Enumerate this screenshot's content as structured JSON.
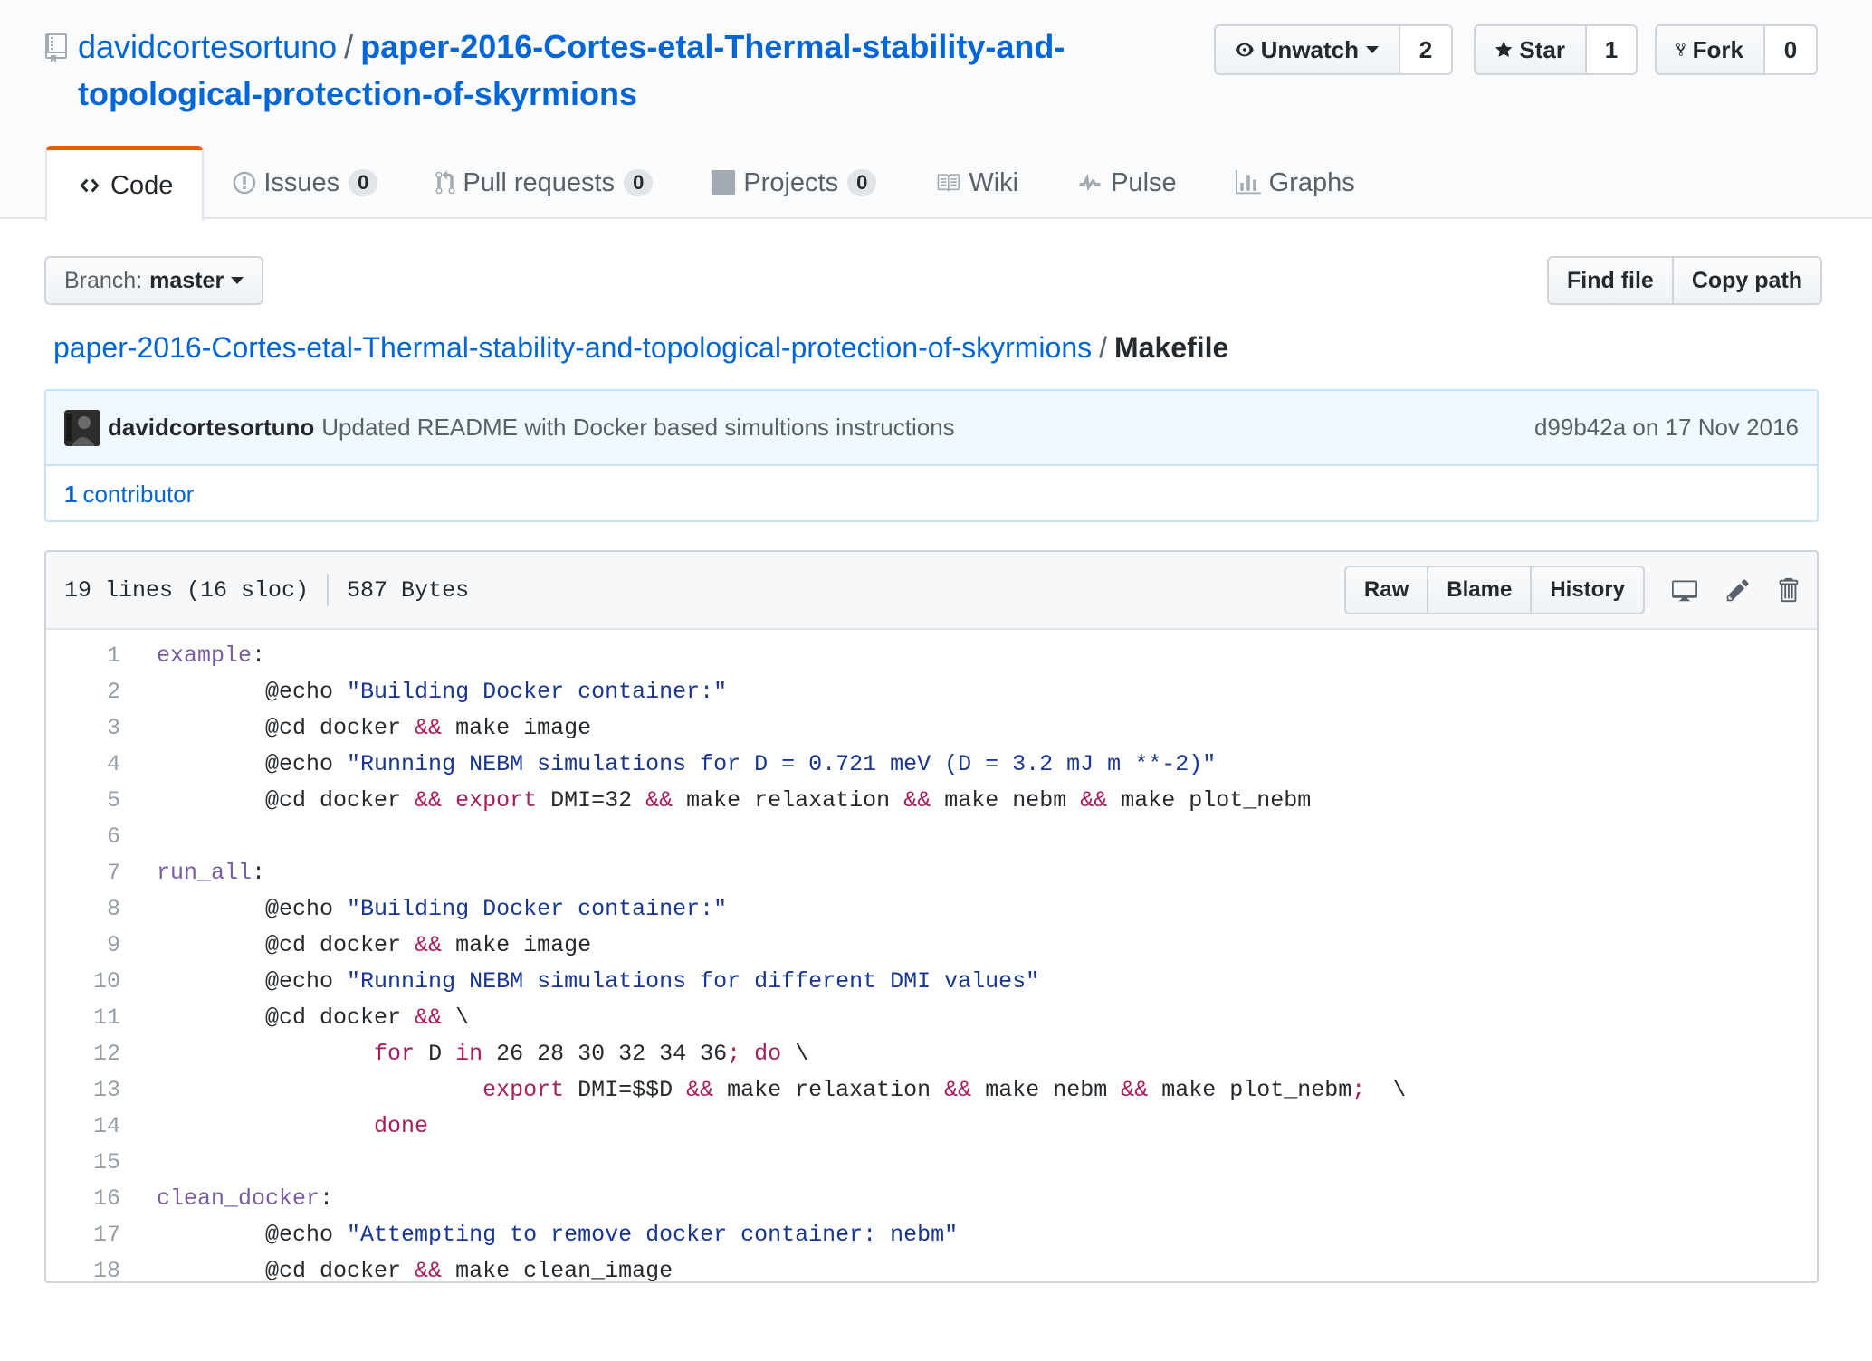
{
  "repo": {
    "owner": "davidcortesortuno",
    "separator": "/",
    "name_line1": "paper-2016-Cortes-etal-Thermal-stability-and-",
    "name_line2": "topological-protection-of-skyrmions"
  },
  "actions": {
    "watch": {
      "label": "Unwatch",
      "count": "2"
    },
    "star": {
      "label": "Star",
      "count": "1"
    },
    "fork": {
      "label": "Fork",
      "count": "0"
    }
  },
  "tabs": [
    {
      "label": "Code",
      "icon": "code-icon"
    },
    {
      "label": "Issues",
      "count": "0",
      "icon": "issue-icon"
    },
    {
      "label": "Pull requests",
      "count": "0",
      "icon": "pull-request-icon"
    },
    {
      "label": "Projects",
      "count": "0",
      "icon": "project-icon"
    },
    {
      "label": "Wiki",
      "icon": "book-icon"
    },
    {
      "label": "Pulse",
      "icon": "pulse-icon"
    },
    {
      "label": "Graphs",
      "icon": "graph-icon"
    }
  ],
  "branch": {
    "prefix": "Branch:",
    "name": "master"
  },
  "file_nav": {
    "find_file": "Find file",
    "copy_path": "Copy path"
  },
  "breadcrumb": {
    "root": "paper-2016-Cortes-etal-Thermal-stability-and-topological-protection-of-skyrmions",
    "separator": "/",
    "file": "Makefile"
  },
  "commit": {
    "author": "davidcortesortuno",
    "message": "Updated README with Docker based simultions instructions",
    "sha": "d99b42a",
    "date": "on 17 Nov 2016",
    "contributors_count": "1",
    "contributors_label": "contributor"
  },
  "file": {
    "lines_info": "19 lines (16 sloc)",
    "size": "587 Bytes",
    "buttons": {
      "raw": "Raw",
      "blame": "Blame",
      "history": "History"
    }
  },
  "code_lines": [
    [
      {
        "t": "t",
        "v": "example"
      },
      {
        "t": "p",
        "v": ":"
      }
    ],
    [
      {
        "t": "p",
        "v": "\t@echo "
      },
      {
        "t": "s",
        "v": "\"Building Docker container:\""
      }
    ],
    [
      {
        "t": "p",
        "v": "\t@cd docker "
      },
      {
        "t": "k",
        "v": "&&"
      },
      {
        "t": "p",
        "v": " make image"
      }
    ],
    [
      {
        "t": "p",
        "v": "\t@echo "
      },
      {
        "t": "s",
        "v": "\"Running NEBM simulations for D = 0.721 meV (D = 3.2 mJ m **-2)\""
      }
    ],
    [
      {
        "t": "p",
        "v": "\t@cd docker "
      },
      {
        "t": "k",
        "v": "&&"
      },
      {
        "t": "p",
        "v": " "
      },
      {
        "t": "k",
        "v": "export"
      },
      {
        "t": "p",
        "v": " DMI=32 "
      },
      {
        "t": "k",
        "v": "&&"
      },
      {
        "t": "p",
        "v": " make relaxation "
      },
      {
        "t": "k",
        "v": "&&"
      },
      {
        "t": "p",
        "v": " make nebm "
      },
      {
        "t": "k",
        "v": "&&"
      },
      {
        "t": "p",
        "v": " make plot_nebm"
      }
    ],
    [],
    [
      {
        "t": "t",
        "v": "run_all"
      },
      {
        "t": "p",
        "v": ":"
      }
    ],
    [
      {
        "t": "p",
        "v": "\t@echo "
      },
      {
        "t": "s",
        "v": "\"Building Docker container:\""
      }
    ],
    [
      {
        "t": "p",
        "v": "\t@cd docker "
      },
      {
        "t": "k",
        "v": "&&"
      },
      {
        "t": "p",
        "v": " make image"
      }
    ],
    [
      {
        "t": "p",
        "v": "\t@echo "
      },
      {
        "t": "s",
        "v": "\"Running NEBM simulations for different DMI values\""
      }
    ],
    [
      {
        "t": "p",
        "v": "\t@cd docker "
      },
      {
        "t": "k",
        "v": "&&"
      },
      {
        "t": "p",
        "v": " \\"
      }
    ],
    [
      {
        "t": "p",
        "v": "\t\t"
      },
      {
        "t": "k",
        "v": "for"
      },
      {
        "t": "p",
        "v": " D "
      },
      {
        "t": "k",
        "v": "in"
      },
      {
        "t": "p",
        "v": " 26 28 30 32 34 36"
      },
      {
        "t": "k",
        "v": ";"
      },
      {
        "t": "p",
        "v": " "
      },
      {
        "t": "k",
        "v": "do"
      },
      {
        "t": "p",
        "v": " \\"
      }
    ],
    [
      {
        "t": "p",
        "v": "\t\t\t"
      },
      {
        "t": "k",
        "v": "export"
      },
      {
        "t": "p",
        "v": " DMI=$$D "
      },
      {
        "t": "k",
        "v": "&&"
      },
      {
        "t": "p",
        "v": " make relaxation "
      },
      {
        "t": "k",
        "v": "&&"
      },
      {
        "t": "p",
        "v": " make nebm "
      },
      {
        "t": "k",
        "v": "&&"
      },
      {
        "t": "p",
        "v": " make plot_nebm"
      },
      {
        "t": "k",
        "v": ";"
      },
      {
        "t": "p",
        "v": "  \\"
      }
    ],
    [
      {
        "t": "p",
        "v": "\t\t"
      },
      {
        "t": "k",
        "v": "done"
      }
    ],
    [],
    [
      {
        "t": "t",
        "v": "clean_docker"
      },
      {
        "t": "p",
        "v": ":"
      }
    ],
    [
      {
        "t": "p",
        "v": "\t@echo "
      },
      {
        "t": "s",
        "v": "\"Attempting to remove docker container: nebm\""
      }
    ],
    [
      {
        "t": "p",
        "v": "\t@cd docker "
      },
      {
        "t": "k",
        "v": "&&"
      },
      {
        "t": "p",
        "v": " make clean_image"
      }
    ]
  ]
}
